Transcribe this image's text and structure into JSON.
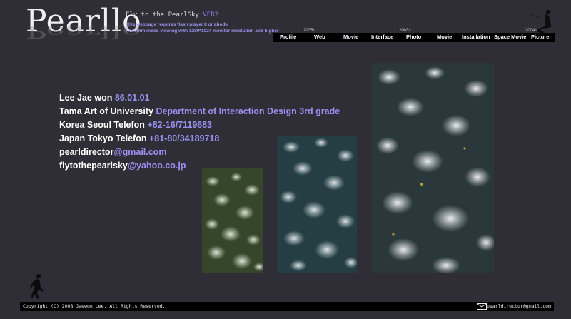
{
  "header": {
    "logo": "Pearllo",
    "tagline": "Fly to the PearlSky",
    "version": "VER2",
    "note_flash": "This webpage requires flash player 8 or abode",
    "note_resolution": "Recommended viewing with 1280*1024 monitor resolution and higher"
  },
  "nav": {
    "years": [
      "2005~",
      "2003~",
      "2004~"
    ],
    "items": [
      "Profile",
      "Web",
      "Movie",
      "Interface",
      "Photo",
      "Movie",
      "Installation",
      "Space Movie",
      "Picture"
    ]
  },
  "profile": {
    "name": "Lee Jae won",
    "birth": "86.01.01",
    "school": "Tama Art of University",
    "department": "Department of Interaction Design 3rd grade",
    "korea_label": "Korea Seoul  Telefon",
    "korea_phone": "+82-16/7119683",
    "japan_label": "Japan Tokyo Telefon",
    "japan_phone": "+81-80/34189718",
    "email1_user": "pearldirector",
    "email1_domain": "@gmail.com",
    "email2_user": "flytothepearlsky",
    "email2_domain": "@yahoo.co.jp"
  },
  "footer": {
    "copyright": "Copyright (C) 2008 Jaewon Lee. All Rights Reserved.",
    "email": "pearldirector@gmail.com"
  }
}
